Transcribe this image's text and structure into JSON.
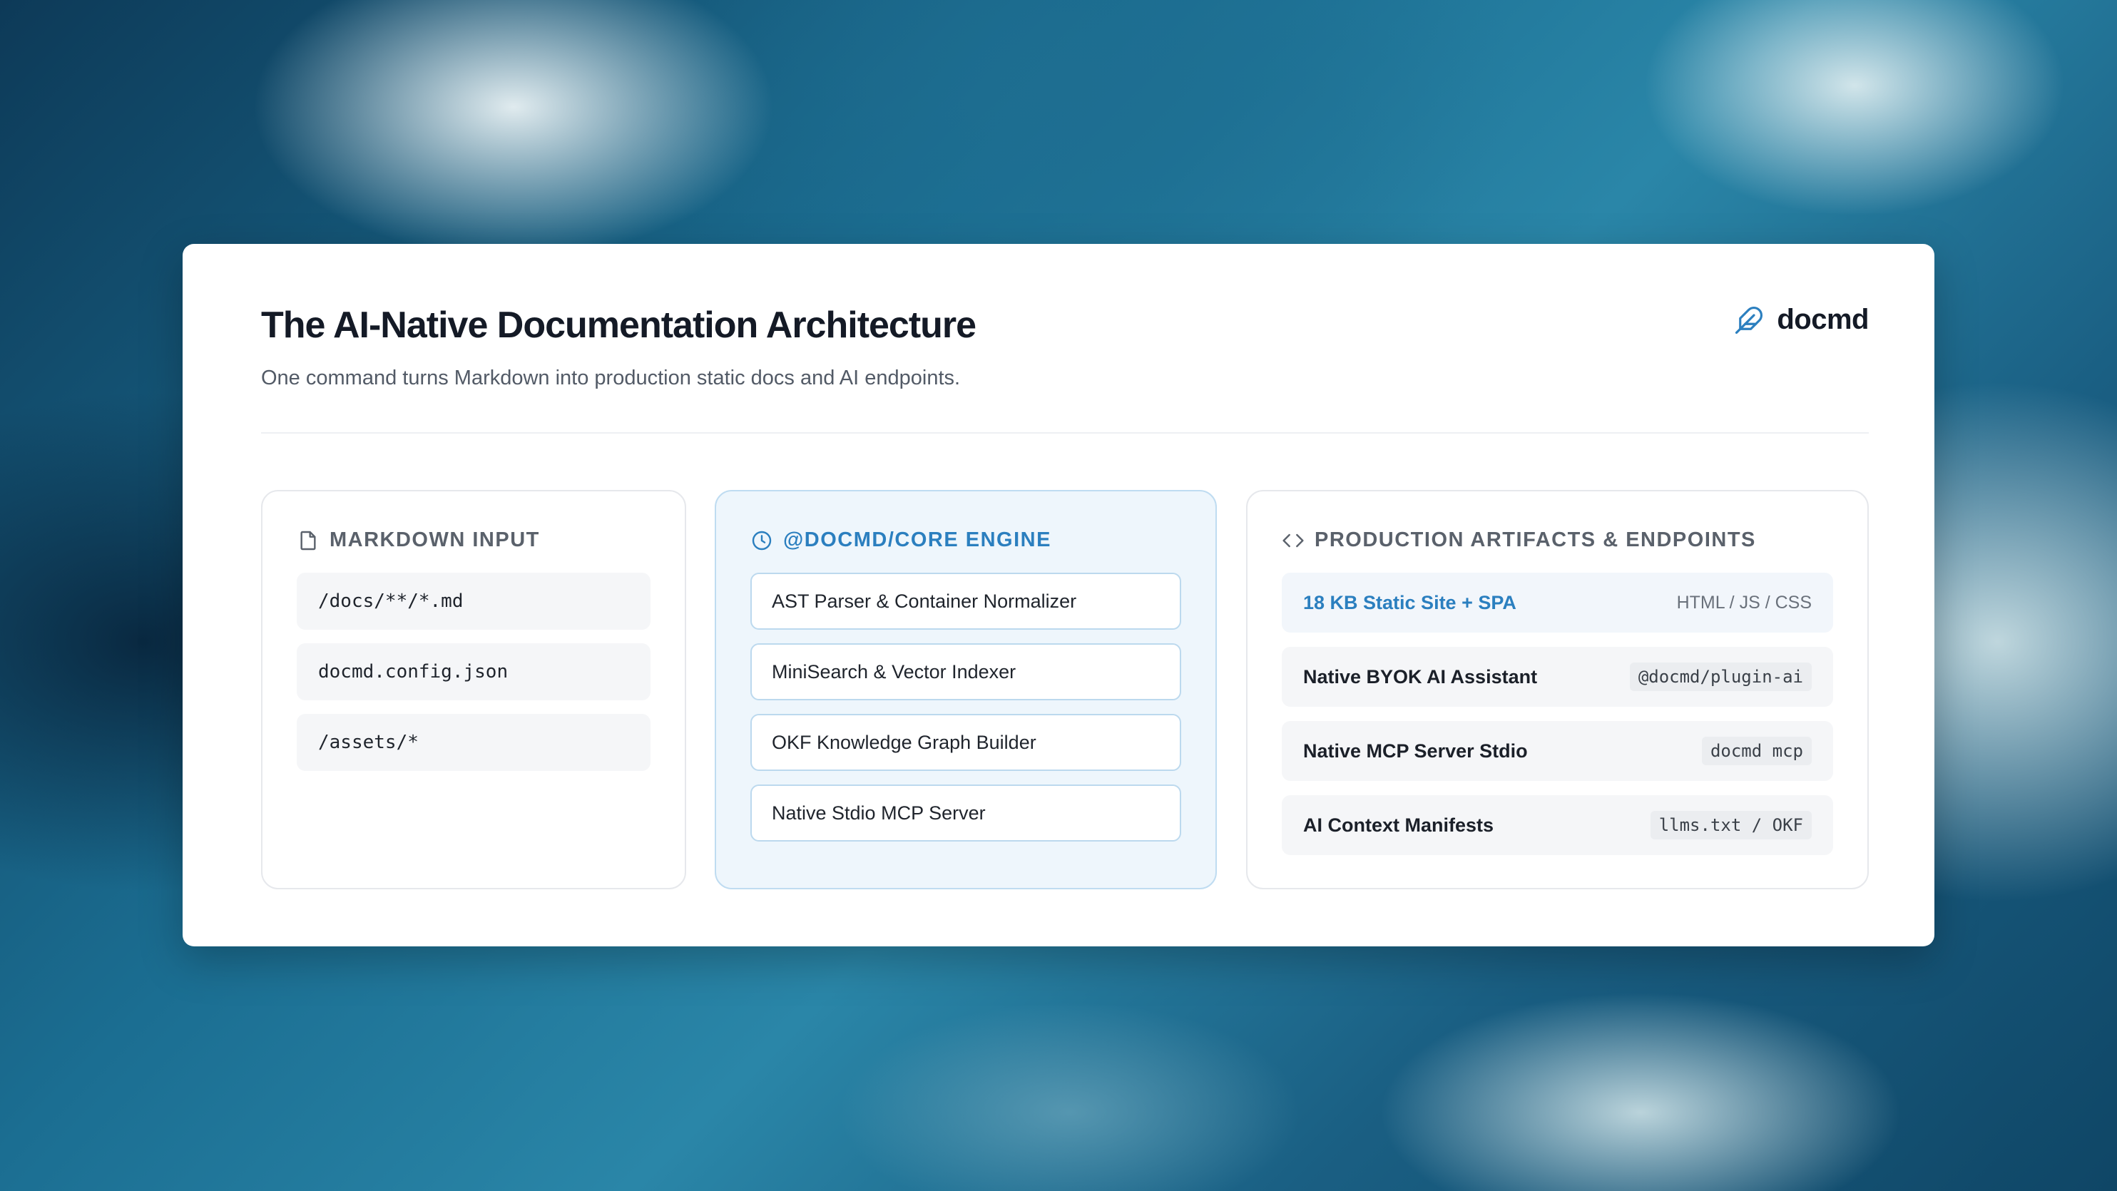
{
  "header": {
    "title": "The AI-Native Documentation Architecture",
    "subtitle": "One command turns Markdown into production static docs and AI endpoints.",
    "brand": "docmd"
  },
  "panels": {
    "input": {
      "title": "MARKDOWN INPUT",
      "icon": "file-icon",
      "items": [
        "/docs/**/*.md",
        "docmd.config.json",
        "/assets/*"
      ]
    },
    "engine": {
      "title": "@DOCMD/CORE ENGINE",
      "icon": "clock-icon",
      "items": [
        "AST Parser & Container Normalizer",
        "MiniSearch & Vector Indexer",
        "OKF Knowledge Graph Builder",
        "Native Stdio MCP Server"
      ]
    },
    "output": {
      "title": "PRODUCTION ARTIFACTS & ENDPOINTS",
      "icon": "code-icon",
      "items": [
        {
          "label": "18 KB Static Site + SPA",
          "meta": "HTML / JS / CSS"
        },
        {
          "label": "Native BYOK AI Assistant",
          "meta": "@docmd/plugin-ai"
        },
        {
          "label": "Native MCP Server Stdio",
          "meta": "docmd mcp"
        },
        {
          "label": "AI Context Manifests",
          "meta": "llms.txt / OKF"
        }
      ]
    }
  },
  "colors": {
    "accent": "#2b7fbf",
    "engine_bg": "#eef6fc",
    "title": "#141a26"
  }
}
